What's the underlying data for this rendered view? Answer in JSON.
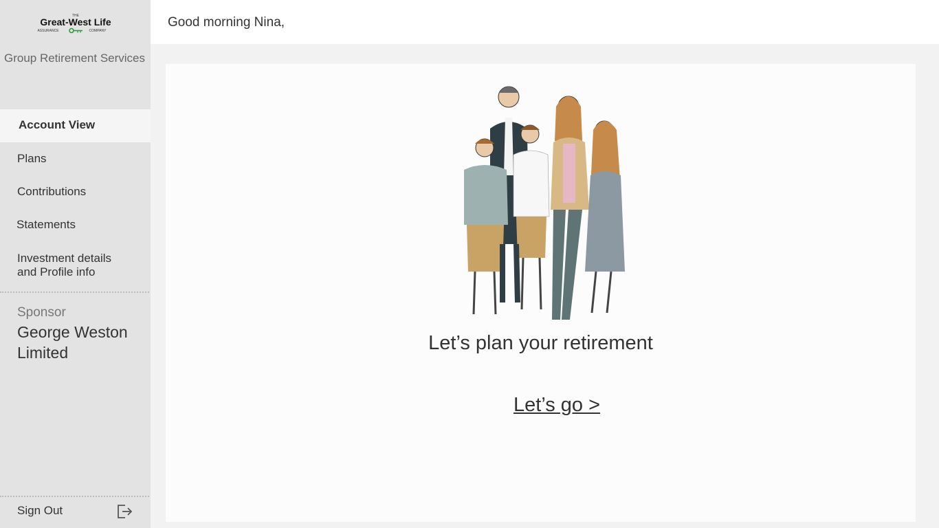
{
  "logo": {
    "top_small": "THE",
    "name": "Great-West Life",
    "left_small": "ASSURANCE",
    "right_small": "COMPANY",
    "brand_green": "#2e9c3a"
  },
  "sidebar": {
    "service_title": "Group Retirement Services",
    "nav": {
      "account_view": "Account View",
      "plans": "Plans",
      "contributions": "Contributions",
      "statements": "Statements",
      "investment_line1": "Investment details",
      "investment_line2": "and Profile info"
    },
    "sponsor_label": "Sponsor",
    "sponsor_name": "George Weston Limited",
    "sign_out": "Sign Out",
    "sign_out_icon": "logout-icon"
  },
  "header": {
    "greeting": "Good morning Nina,"
  },
  "main": {
    "illustration": "family-illustration",
    "headline": "Let’s plan your retirement",
    "cta": "Let’s go >"
  },
  "colors": {
    "sidebar_bg": "#e3e3e3",
    "active_bg": "#f5f5f5",
    "page_bg": "#f2f2f2",
    "card_bg": "#fcfcfc"
  }
}
